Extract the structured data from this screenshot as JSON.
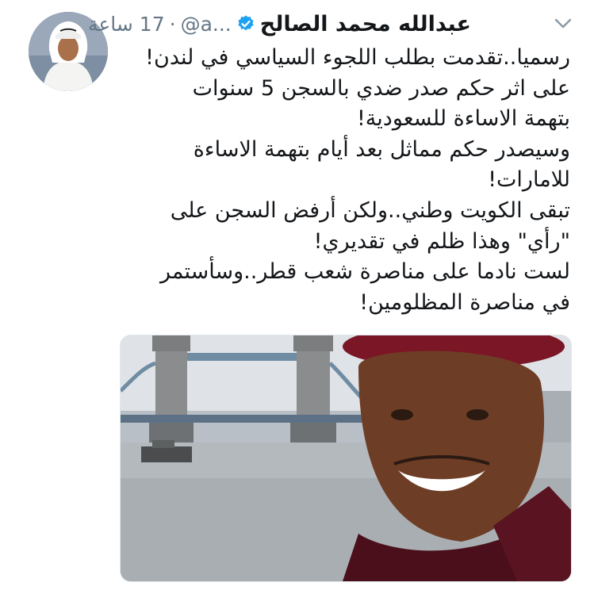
{
  "tweet": {
    "display_name": "عبدالله محمد الصالح",
    "handle": "@a...",
    "separator": "·",
    "time": "17 ساعة",
    "lines": [
      "رسميا..تقدمت بطلب اللجوء السياسي في لندن!",
      "على اثر حكم صدر ضدي بالسجن 5 سنوات",
      "بتهمة الاساءة للسعودية!",
      "وسيصدر حكم مماثل بعد أيام بتهمة الاساءة",
      "للامارات!",
      "تبقى الكويت وطني..ولكن أرفض السجن على",
      "\"رأي\" وهذا ظلم في تقديري!",
      "لست نادما على مناصرة شعب قطر..وسأستمر",
      "في مناصرة المظلومين!"
    ]
  },
  "icons": {
    "verified": "verified-badge-icon",
    "menu": "chevron-down-icon"
  },
  "colors": {
    "verified_blue": "#1da1f2",
    "secondary_text": "#657786"
  }
}
